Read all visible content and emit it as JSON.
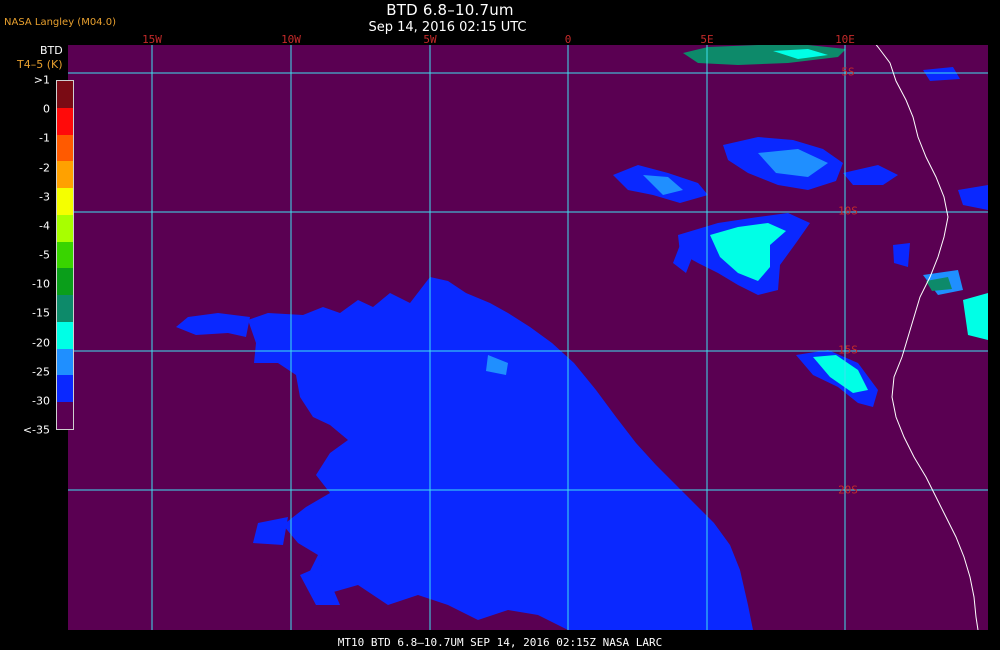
{
  "header": {
    "credit": "NASA Langley (M04.0)",
    "title": "BTD 6.8–10.7um",
    "subtitle": "Sep 14, 2016 02:15 UTC"
  },
  "legend": {
    "title": "BTD",
    "units": "T4–5 (K)",
    "labels": [
      ">1",
      "0",
      "-1",
      "-2",
      "-3",
      "-4",
      "-5",
      "-10",
      "-15",
      "-20",
      "-25",
      "-30",
      "<-35"
    ],
    "colors": [
      "#7a0b14",
      "#ff0a0a",
      "#ff5a00",
      "#ffa100",
      "#f5ff00",
      "#a8ff00",
      "#39d400",
      "#0a9e1a",
      "#0d8a6a",
      "#00ffe6",
      "#1f8fff",
      "#0a28ff",
      "#5a0052"
    ]
  },
  "grid": {
    "longitudes": [
      "15W",
      "10W",
      "5W",
      "0",
      "5E",
      "10E"
    ],
    "latitudes": [
      "5S",
      "10S",
      "15S",
      "20S"
    ],
    "line_color": "#3ee0f0"
  },
  "colors": {
    "background_class": "#5a0052",
    "coastline": "#ffffff"
  },
  "footer": {
    "caption": "MT10  BTD 6.8–10.7UM   SEP 14, 2016 02:15Z   NASA LARC"
  }
}
